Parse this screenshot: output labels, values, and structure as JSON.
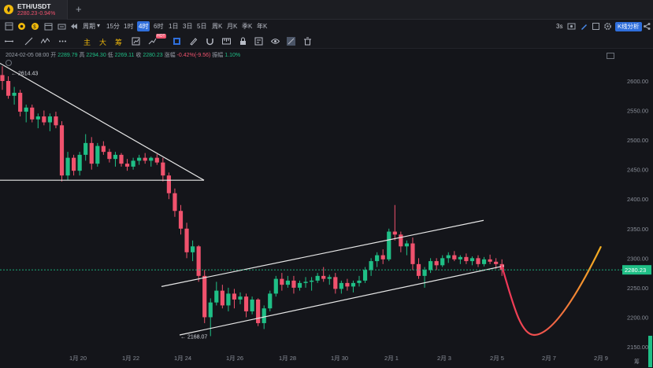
{
  "tab": {
    "symbol": "ETH/USDT",
    "price": "2280.23",
    "change": "-0.94%"
  },
  "toolbar": {
    "period_label": "周期",
    "timeframes": [
      "15分",
      "1时",
      "4时",
      "6时",
      "1日",
      "3日",
      "5日",
      "周K",
      "月K",
      "季K",
      "年K"
    ],
    "active_timeframe": "4时",
    "interval": "3s",
    "kline_button": "K线分析"
  },
  "toolbar2": {
    "main_label": "主",
    "big_label": "大",
    "chou_label": "筹",
    "hot_badge": "HOT"
  },
  "ohlc": {
    "date": "2024-02-05 08:00",
    "open_label": "开",
    "open": "2289.79",
    "high_label": "高",
    "high": "2294.30",
    "low_label": "低",
    "low": "2269.11",
    "close_label": "收",
    "close": "2280.23",
    "change_label": "涨幅",
    "change": "-0.42%(-9.56)",
    "amp_label": "振幅",
    "amp": "1.10%"
  },
  "chart": {
    "price_axis": [
      "2600.00",
      "2550.00",
      "2500.00",
      "2450.00",
      "2400.00",
      "2350.00",
      "2300.00",
      "2250.00",
      "2200.00",
      "2150.00"
    ],
    "date_axis": [
      "1月 20",
      "1月 22",
      "1月 24",
      "1月 26",
      "1月 28",
      "1月 30",
      "2月 1",
      "2月 3",
      "2月 5",
      "2月 7",
      "2月 9"
    ],
    "current_price": "2280.23",
    "high_marker": "2614.43",
    "low_marker": "2168.07",
    "bottom_right_label": "筹"
  },
  "chart_data": {
    "type": "candlestick",
    "x_unit": "4h bars",
    "ylim": [
      2130,
      2640
    ],
    "candles": [
      [
        2610,
        2625,
        2585,
        2600
      ],
      [
        2600,
        2608,
        2570,
        2575
      ],
      [
        2575,
        2590,
        2560,
        2580
      ],
      [
        2580,
        2585,
        2540,
        2548
      ],
      [
        2548,
        2560,
        2530,
        2555
      ],
      [
        2555,
        2560,
        2530,
        2535
      ],
      [
        2535,
        2545,
        2520,
        2540
      ],
      [
        2540,
        2550,
        2525,
        2530
      ],
      [
        2530,
        2545,
        2515,
        2540
      ],
      [
        2540,
        2548,
        2520,
        2525
      ],
      [
        2525,
        2532,
        2430,
        2440
      ],
      [
        2440,
        2480,
        2432,
        2470
      ],
      [
        2470,
        2475,
        2440,
        2448
      ],
      [
        2448,
        2480,
        2440,
        2475
      ],
      [
        2475,
        2510,
        2465,
        2495
      ],
      [
        2495,
        2505,
        2450,
        2460
      ],
      [
        2460,
        2495,
        2455,
        2490
      ],
      [
        2490,
        2498,
        2475,
        2480
      ],
      [
        2480,
        2485,
        2462,
        2468
      ],
      [
        2468,
        2480,
        2455,
        2475
      ],
      [
        2475,
        2478,
        2455,
        2460
      ],
      [
        2460,
        2468,
        2448,
        2455
      ],
      [
        2455,
        2470,
        2450,
        2465
      ],
      [
        2465,
        2475,
        2458,
        2470
      ],
      [
        2470,
        2478,
        2460,
        2465
      ],
      [
        2465,
        2472,
        2455,
        2470
      ],
      [
        2470,
        2476,
        2458,
        2462
      ],
      [
        2462,
        2470,
        2430,
        2440
      ],
      [
        2440,
        2445,
        2400,
        2410
      ],
      [
        2410,
        2418,
        2370,
        2380
      ],
      [
        2380,
        2390,
        2340,
        2350
      ],
      [
        2350,
        2360,
        2300,
        2310
      ],
      [
        2310,
        2330,
        2295,
        2320
      ],
      [
        2320,
        2322,
        2260,
        2270
      ],
      [
        2270,
        2280,
        2190,
        2200
      ],
      [
        2200,
        2232,
        2168,
        2225
      ],
      [
        2225,
        2260,
        2220,
        2245
      ],
      [
        2245,
        2255,
        2215,
        2220
      ],
      [
        2220,
        2250,
        2210,
        2240
      ],
      [
        2240,
        2248,
        2215,
        2230
      ],
      [
        2230,
        2242,
        2222,
        2235
      ],
      [
        2235,
        2240,
        2200,
        2210
      ],
      [
        2210,
        2235,
        2205,
        2230
      ],
      [
        2230,
        2232,
        2185,
        2190
      ],
      [
        2190,
        2220,
        2180,
        2215
      ],
      [
        2215,
        2245,
        2210,
        2240
      ],
      [
        2240,
        2270,
        2235,
        2265
      ],
      [
        2265,
        2275,
        2245,
        2255
      ],
      [
        2255,
        2270,
        2250,
        2262
      ],
      [
        2262,
        2270,
        2240,
        2250
      ],
      [
        2250,
        2262,
        2245,
        2258
      ],
      [
        2258,
        2268,
        2250,
        2260
      ],
      [
        2260,
        2268,
        2245,
        2262
      ],
      [
        2262,
        2275,
        2258,
        2270
      ],
      [
        2270,
        2285,
        2260,
        2265
      ],
      [
        2265,
        2272,
        2255,
        2268
      ],
      [
        2268,
        2275,
        2240,
        2248
      ],
      [
        2248,
        2262,
        2240,
        2258
      ],
      [
        2258,
        2265,
        2245,
        2252
      ],
      [
        2252,
        2262,
        2242,
        2258
      ],
      [
        2258,
        2270,
        2252,
        2262
      ],
      [
        2262,
        2285,
        2258,
        2280
      ],
      [
        2280,
        2300,
        2270,
        2295
      ],
      [
        2295,
        2310,
        2285,
        2305
      ],
      [
        2305,
        2315,
        2290,
        2298
      ],
      [
        2298,
        2350,
        2295,
        2345
      ],
      [
        2345,
        2390,
        2330,
        2340
      ],
      [
        2340,
        2345,
        2310,
        2320
      ],
      [
        2320,
        2330,
        2305,
        2325
      ],
      [
        2325,
        2335,
        2280,
        2290
      ],
      [
        2290,
        2300,
        2265,
        2270
      ],
      [
        2270,
        2285,
        2250,
        2280
      ],
      [
        2280,
        2300,
        2275,
        2295
      ],
      [
        2295,
        2300,
        2280,
        2288
      ],
      [
        2288,
        2305,
        2285,
        2300
      ],
      [
        2300,
        2310,
        2292,
        2305
      ],
      [
        2305,
        2312,
        2295,
        2298
      ],
      [
        2298,
        2305,
        2290,
        2302
      ],
      [
        2302,
        2308,
        2290,
        2295
      ],
      [
        2295,
        2303,
        2288,
        2300
      ],
      [
        2300,
        2305,
        2285,
        2290
      ],
      [
        2290,
        2302,
        2286,
        2298
      ],
      [
        2298,
        2306,
        2290,
        2294
      ],
      [
        2294,
        2300,
        2282,
        2290
      ],
      [
        2290,
        2298,
        2270,
        2280
      ]
    ],
    "projection": "curve down to ~2170 then up toward ~2320"
  },
  "colors": {
    "up": "#1fbf86",
    "down": "#f0526d",
    "accent": "#2f6fdc",
    "bg": "#14151a"
  }
}
